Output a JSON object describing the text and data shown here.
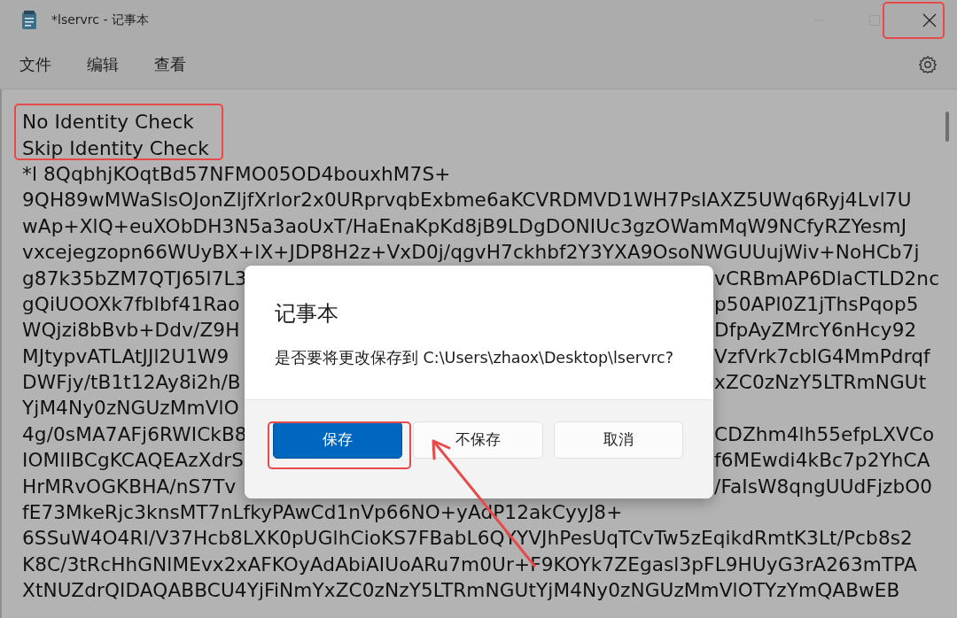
{
  "window": {
    "title": "*lservrc - 记事本"
  },
  "menu": [
    "文件",
    "编辑",
    "查看"
  ],
  "editor": {
    "lines": [
      {
        "kind": "full",
        "text": "No Identity Check"
      },
      {
        "kind": "full",
        "text": "Skip Identity Check"
      },
      {
        "kind": "full",
        "text": "*l 8QqbhjKOqtBd57NFMO05OD4bouxhM7S+"
      },
      {
        "kind": "full",
        "text": "9QH89wMWaSlsOJonZljfXrIor2x0URprvqbExbme6aKCVRDMVD1WH7PsIAXZ5UWq6Ryj4Lvl7U"
      },
      {
        "kind": "full",
        "text": "wAp+XlQ+euXObDH3N5a3aoUxT/HaEnaKpKd8jB9LDgDONIUc3gzOWamMqW9NCfyRZYesmJ"
      },
      {
        "kind": "full",
        "text": "vxcejegzopn66WUyBX+lX+JDP8H2z+VxD0j/qgvH7ckhbf2Y3YXA9OsoNWGUUujWiv+NoHCb7j"
      },
      {
        "kind": "split",
        "left": "g87k35bZM7QTJ65l7L3",
        "right": "vCRBmAP6DlaCTLD2nc"
      },
      {
        "kind": "split",
        "left": "gQiUOOXk7fbIbf41Rao",
        "right": "p50APl0Z1jThsPqop5"
      },
      {
        "kind": "split",
        "left": "WQjzi8bBvb+Ddv/Z9H",
        "right": "DfpAyZMrcY6nHcy92"
      },
      {
        "kind": "split",
        "left": "MJtypvATLAtJJl2U1W9",
        "right": "VzfVrk7cblG4MmPdrqf"
      },
      {
        "kind": "split",
        "left": "DWFjy/tB1t12Ay8i2h/B",
        "right": "xZC0zNzY5LTRmNGUt"
      },
      {
        "kind": "split",
        "left": "YjM4Ny0zNGUzMmVlO"
      },
      {
        "kind": "split",
        "left": "4g/0sMA7AFj6RWICkB8",
        "right": "CDZhm4lh55efpLXVCo"
      },
      {
        "kind": "split",
        "left": "IOMIIBCgKCAQEAzXdrS",
        "right": "f6MEwdi4kBc7p2YhCA"
      },
      {
        "kind": "split",
        "left": "HrMRvOGKBHA/nS7Tv",
        "right": "/FaIsW8qngUUdFjzbO0"
      },
      {
        "kind": "full",
        "text": "fE73MkeRjc3knsMT7nLfkyPAwCd1nVp66NO+yAdP12akCyyJ8+"
      },
      {
        "kind": "full",
        "text": "6SSuW4O4RI/V37Hcb8LXK0pUGlhCioKS7FBabL6QYYVJhPesUqTCvTw5zEqikdRmtK3Lt/Pcb8s2"
      },
      {
        "kind": "full",
        "text": "K8C/3tRcHhGNlMEvx2xAFKOyAdAbiAIUoARu7m0Ur+F9KOYk7ZEgasl3pFL9HUyG3rA263mTPA"
      },
      {
        "kind": "full",
        "text": "XtNUZdrQIDAQABBCU4YjFiNmYxZC0zNzY5LTRmNGUtYjM4Ny0zNGUzMmVlOTYzYmQABwEB"
      }
    ]
  },
  "dialog": {
    "title": "记事本",
    "message": "是否要将更改保存到 C:\\Users\\zhaox\\Desktop\\lservrc?",
    "buttons": [
      {
        "label": "保存",
        "kind": "primary"
      },
      {
        "label": "不保存",
        "kind": "secondary"
      },
      {
        "label": "取消",
        "kind": "secondary"
      }
    ]
  }
}
